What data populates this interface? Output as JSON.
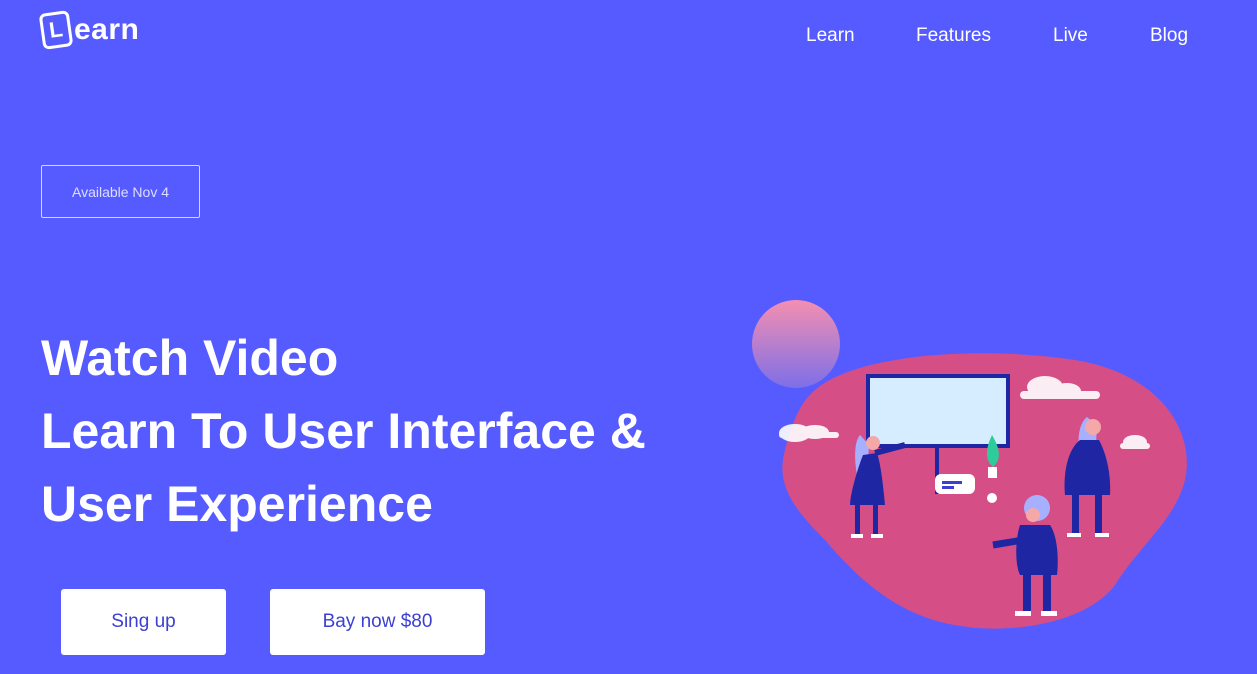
{
  "logo": {
    "mark": "L",
    "text": "earn"
  },
  "nav": {
    "items": [
      "Learn",
      "Features",
      "Live",
      "Blog"
    ]
  },
  "badge": {
    "label": "Available Nov 4"
  },
  "hero": {
    "line1": "Watch Video",
    "line2": "Learn To User Interface &",
    "line3": "User Experience"
  },
  "buttons": {
    "signup": "Sing up",
    "buy": "Bay now $80"
  },
  "colors": {
    "background": "#565bff",
    "blob": "#d54f86",
    "button_text": "#3c3fd1",
    "figure_dark": "#1f26a3",
    "screen": "#d6ecff"
  },
  "illustration": {
    "name": "people-with-whiteboard-illustration"
  }
}
